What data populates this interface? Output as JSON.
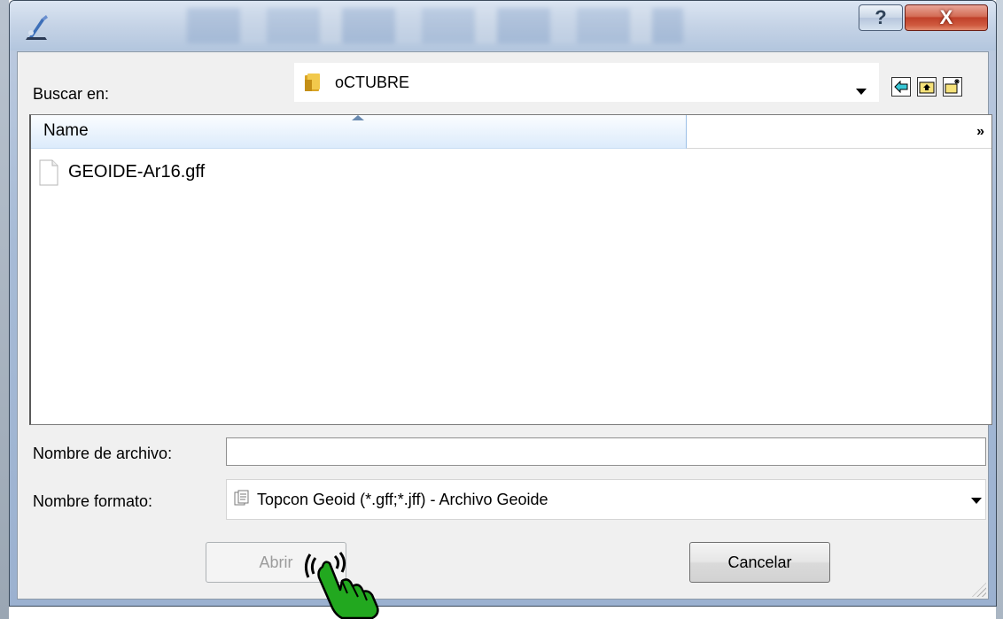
{
  "titlebar": {
    "help_label": "?",
    "close_label": "X"
  },
  "toolbar": {
    "look_in_label": "Buscar en:",
    "current_folder": "oCTUBRE"
  },
  "file_list": {
    "column_name": "Name",
    "more_columns": "»",
    "files": [
      {
        "name": "GEOIDE-Ar16.gff"
      }
    ]
  },
  "filename": {
    "label": "Nombre de archivo:",
    "value": ""
  },
  "format": {
    "label": "Nombre formato:",
    "selected": "Topcon Geoid (*.gff;*.jff) - Archivo Geoide"
  },
  "buttons": {
    "open": "Abrir",
    "cancel": "Cancelar"
  },
  "colors": {
    "titlebar": "#c5d3e6",
    "client_bg": "#f0f0f0",
    "close_button": "#c0402a",
    "column_header": "#dcebfb",
    "cursor_hand": "#1fa31f"
  }
}
